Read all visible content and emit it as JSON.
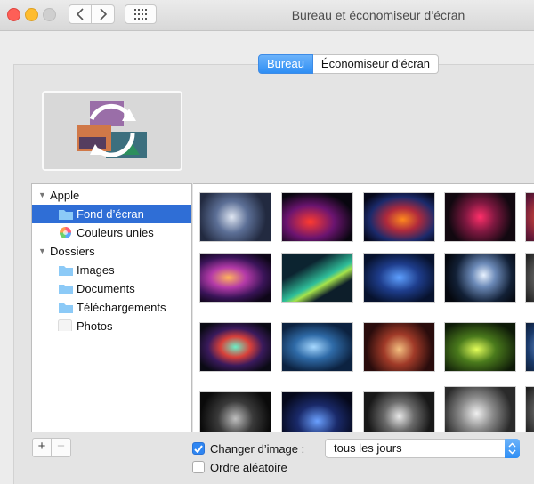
{
  "window": {
    "title": "Bureau et économiseur d’écran"
  },
  "tabs": [
    {
      "label": "Bureau",
      "active": true
    },
    {
      "label": "Économiseur d’écran",
      "active": false
    }
  ],
  "sidebar": {
    "items": [
      {
        "label": "Apple",
        "type": "group",
        "icon": "disclosure-triangle-icon"
      },
      {
        "label": "Fond d’écran",
        "type": "folder",
        "selected": true,
        "icon": "folder-icon"
      },
      {
        "label": "Couleurs unies",
        "type": "colors",
        "icon": "color-wheel-icon"
      },
      {
        "label": "Dossiers",
        "type": "group",
        "icon": "disclosure-triangle-icon"
      },
      {
        "label": "Images",
        "type": "folder",
        "icon": "folder-icon"
      },
      {
        "label": "Documents",
        "type": "folder",
        "icon": "folder-icon"
      },
      {
        "label": "Téléchargements",
        "type": "folder",
        "icon": "folder-icon"
      },
      {
        "label": "Photos",
        "type": "photos",
        "icon": "photos-icon"
      }
    ]
  },
  "buttons": {
    "add": "+",
    "remove": "−"
  },
  "options": {
    "change_picture_label": "Changer d’image :",
    "change_picture_checked": true,
    "random_order_label": "Ordre aléatoire",
    "random_order_checked": false,
    "interval_value": "tous les jours"
  },
  "colors": {
    "accent": "#2f86f2",
    "selection": "#2f6ed6"
  }
}
